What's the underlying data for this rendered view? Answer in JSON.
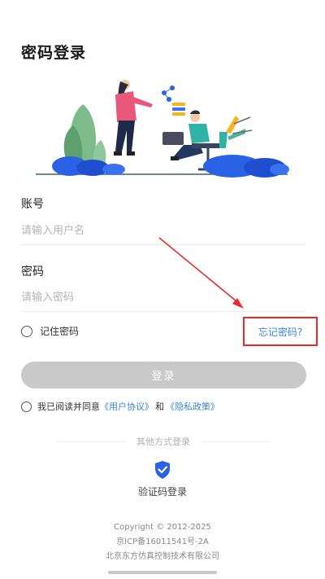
{
  "title": "密码登录",
  "account": {
    "label": "账号",
    "placeholder": "请输入用户名"
  },
  "password": {
    "label": "密码",
    "placeholder": "请输入密码"
  },
  "remember_label": "记住密码",
  "forgot_label": "忘记密码?",
  "login_label": "登录",
  "agreement": {
    "prefix": "我已阅读并同意",
    "user_link": "《用户协议》",
    "and": "和",
    "privacy_link": "《隐私政策》"
  },
  "other_methods_label": "其他方式登录",
  "sms_login": {
    "label": "验证码登录",
    "icon": "shield-check-icon"
  },
  "footer": {
    "copyright": "Copyright © 2012-2025",
    "icp": "京ICP备16011541号-2A",
    "company": "北京东方仿真控制技术有限公司"
  },
  "colors": {
    "link": "#3b86d6",
    "annotation_red": "#ea2a2a",
    "button_disabled": "#c9c9c9",
    "illustration_blue": "#2a62e6"
  }
}
